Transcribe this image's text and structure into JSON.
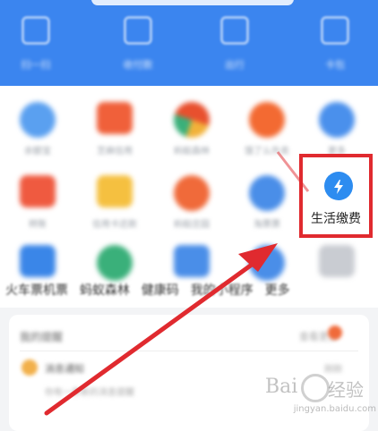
{
  "header": {
    "quick_actions": [
      {
        "label": "扫一扫",
        "icon": "scan-icon"
      },
      {
        "label": "收付款",
        "icon": "payment-code-icon"
      },
      {
        "label": "出行",
        "icon": "travel-icon"
      },
      {
        "label": "卡包",
        "icon": "card-pack-icon"
      }
    ],
    "color": "#3b85ef"
  },
  "grid": {
    "row1": [
      {
        "label": "余额宝",
        "icon": "yuebao-icon",
        "color": "#5aa0f0"
      },
      {
        "label": "芝麻信用",
        "icon": "sesame-icon",
        "color": "#f0603a"
      },
      {
        "label": "蚂蚁森林",
        "icon": "forest-icon",
        "color": "#e8502e"
      },
      {
        "label": "饿了么外卖",
        "icon": "food-icon",
        "color": "#f36a32"
      },
      {
        "label": "更多",
        "icon": "more-icon",
        "color": "#4a90ec"
      }
    ],
    "row2": [
      {
        "label": "转账",
        "icon": "transfer-icon",
        "color": "#ef5a40"
      },
      {
        "label": "信用卡还款",
        "icon": "credit-card-icon",
        "color": "#f5c040"
      },
      {
        "label": "蚂蚁庄园",
        "icon": "farm-icon",
        "color": "#f06a3a"
      },
      {
        "label": "淘票票",
        "icon": "ticket-icon",
        "color": "#4a8ee8"
      },
      {
        "label": "生活缴费",
        "icon": "lightning-icon",
        "color": "#2d8cf0"
      }
    ],
    "row3": [
      {
        "label": "火车票机票",
        "icon": "train-icon",
        "color": "#3a86e8"
      },
      {
        "label": "蚂蚁森林",
        "icon": "tree-icon",
        "color": "#3ab07a"
      },
      {
        "label": "健康码",
        "icon": "health-icon",
        "color": "#4a8ee8"
      },
      {
        "label": "我的小程序",
        "icon": "miniapp-icon",
        "color": "#4a8ee8"
      },
      {
        "label": "更多",
        "icon": "grid-more-icon",
        "color": "#c9ccd2"
      }
    ],
    "row3_visible": "火车票机票  蚂蚁森林  健康码  我的小程序  更多"
  },
  "highlight": {
    "color": "#e02a2f",
    "label": "生活缴费"
  },
  "card": {
    "title": "我的提醒",
    "more": "查看更多",
    "item_title": "消息通知",
    "item_sub": "你有一条新的消息提醒",
    "item_time": "刚刚"
  },
  "watermark": {
    "text": "Bai",
    "text2": "经验",
    "sub": "jingyan.baidu.com"
  },
  "arrow": {
    "color": "#e02a2f"
  }
}
